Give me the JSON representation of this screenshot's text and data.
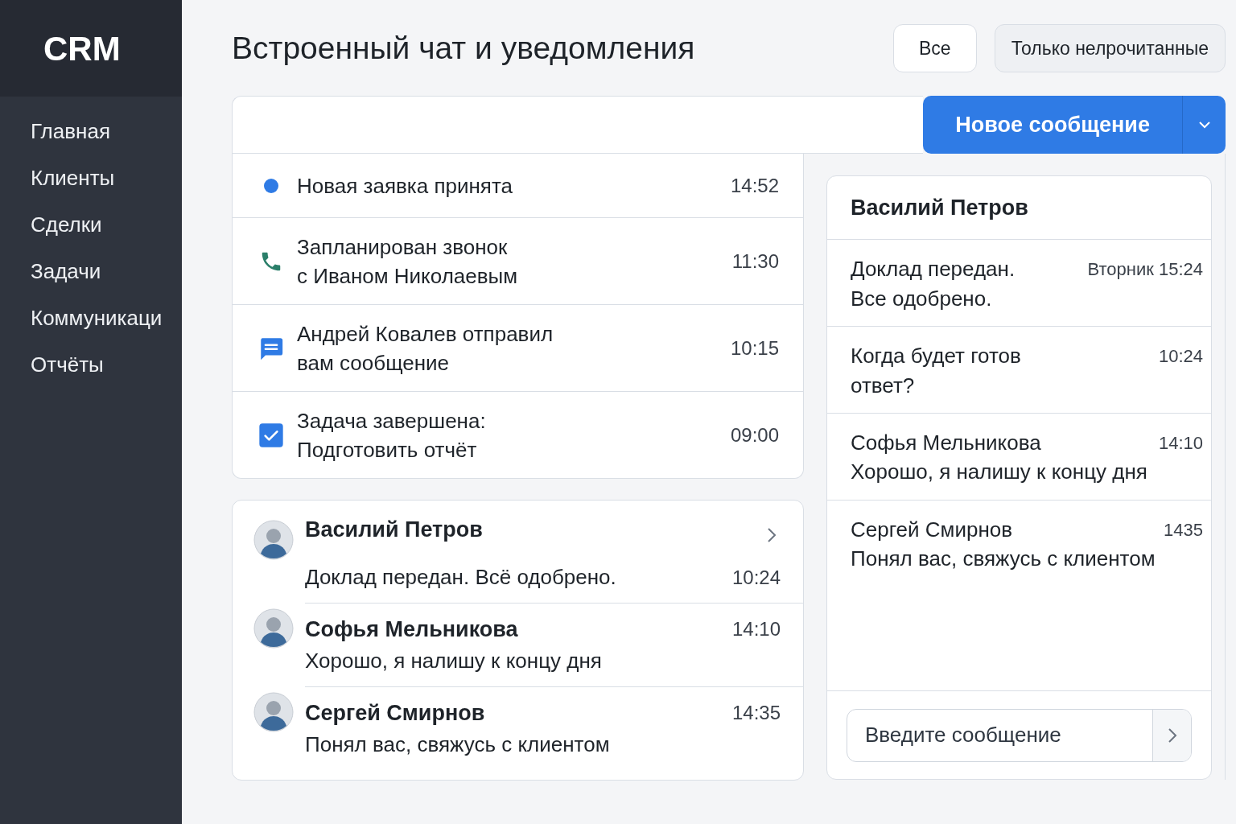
{
  "sidebar": {
    "logo": "CRM",
    "items": [
      {
        "label": "Главная"
      },
      {
        "label": "Клиенты"
      },
      {
        "label": "Сделки"
      },
      {
        "label": "Задачи"
      },
      {
        "label": "Коммуникаци"
      },
      {
        "label": "Отчёты"
      }
    ]
  },
  "title": "Встроенный чат и уведомления",
  "filters": [
    {
      "label": "Все",
      "selected": true
    },
    {
      "label": "Только нелрочитанные",
      "selected": false
    }
  ],
  "new_message_button": {
    "label": "Новое сообщение"
  },
  "notifications": [
    {
      "kind": "dot",
      "text": "Новая заявка принята",
      "time": "14:52"
    },
    {
      "kind": "call",
      "text": "Запланирован звонок\nс Иваном Николаевым",
      "time": "11:30"
    },
    {
      "kind": "message",
      "text": "Андрей Ковалев отправил\nвам сообщение",
      "time": "10:15"
    },
    {
      "kind": "task",
      "text": "Задача завершена:\nПодготовить отчёт",
      "time": "09:00"
    }
  ],
  "conversations": [
    {
      "name": "Василий Петров",
      "text": "Доклад передан. Всё одобрено.",
      "time": "10:24",
      "selected": true
    },
    {
      "name": "Софья Мельникова",
      "text": "Хорошо, я налишу к концу дня",
      "time": "14:10",
      "selected": false
    },
    {
      "name": "Сергей Смирнов",
      "text": "Понял вас, свяжусь с клиентом",
      "time": "14:35",
      "selected": false
    }
  ],
  "chat": {
    "title": "Василий Петров",
    "messages": [
      {
        "text": "Доклад передан.\nВсе одобрено.",
        "time": "Вторник 15:24"
      },
      {
        "text": "Когда будет готов\nответ?",
        "time": "10:24"
      },
      {
        "name": "Софья Мельникова",
        "text": "Хорошо, я налишу к концу дня",
        "time": "14:10"
      },
      {
        "name": "Сергей Смирнов",
        "text": "Понял вас, свяжусь с клиентом",
        "time": "1435"
      }
    ],
    "input": {
      "placeholder": "Введите сообщение"
    }
  }
}
